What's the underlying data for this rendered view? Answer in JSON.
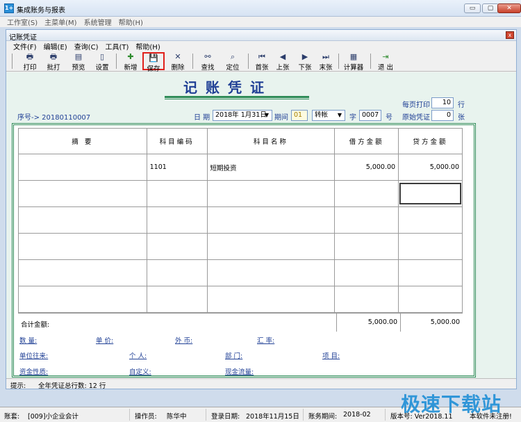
{
  "app": {
    "title": "集成账务与报表"
  },
  "outer_menu": [
    "工作室(S)",
    "主菜单(M)",
    "系统管理",
    "帮助(H)"
  ],
  "window_buttons": {
    "minimize": "▭",
    "maximize": "▢",
    "close": "✕"
  },
  "inner": {
    "title": "记账凭证",
    "close": "x",
    "menu": [
      "文件(F)",
      "编辑(E)",
      "查询(C)",
      "工具(T)",
      "帮助(H)"
    ]
  },
  "toolbar": {
    "print": "打印",
    "batch_print": "批打",
    "preview": "预览",
    "settings": "设置",
    "add": "新增",
    "save": "保存",
    "delete": "删除",
    "find": "查找",
    "locate": "定位",
    "first": "首张",
    "prev": "上张",
    "next": "下张",
    "last": "末张",
    "calculator": "计算器",
    "exit": "退 出"
  },
  "voucher": {
    "title": "记账凭证",
    "seq_label": "序号-> 20180110007",
    "date_label": "日 期",
    "date_value": "2018年 1月31日",
    "period_label": "期间",
    "period_value": "01",
    "type_value": "转帐",
    "word_label": "字",
    "word_value": "0007",
    "number_label": "号",
    "per_page_label": "每页打印",
    "per_page_value": "10",
    "per_page_unit": "行",
    "orig_label": "原始凭证",
    "orig_value": "0",
    "orig_unit": "张"
  },
  "grid": {
    "headers": [
      "摘 要",
      "科目编码",
      "科目名称",
      "借方金额",
      "贷方金额"
    ],
    "rows": [
      {
        "summary": "",
        "code": "1101",
        "name": "短期投资",
        "debit": "5,000.00",
        "credit": "5,000.00"
      },
      {
        "summary": "",
        "code": "",
        "name": "",
        "debit": "",
        "credit": ""
      },
      {
        "summary": "",
        "code": "",
        "name": "",
        "debit": "",
        "credit": ""
      },
      {
        "summary": "",
        "code": "",
        "name": "",
        "debit": "",
        "credit": ""
      },
      {
        "summary": "",
        "code": "",
        "name": "",
        "debit": "",
        "credit": ""
      },
      {
        "summary": "",
        "code": "",
        "name": "",
        "debit": "",
        "credit": ""
      }
    ],
    "total_label": "合计金额:",
    "total_debit": "5,000.00",
    "total_credit": "5,000.00"
  },
  "aux_fields": {
    "quantity": "数 量:",
    "unit_price": "单 价:",
    "foreign": "外 币:",
    "rate": "汇 率:",
    "unit_trans": "单位往来:",
    "person": "个 人:",
    "dept": "部 门:",
    "project": "项 目:",
    "fund_nature": "资金性质:",
    "custom": "自定义:",
    "cash_flow": "现金流量:"
  },
  "hint": {
    "label": "提示:",
    "text": "全年凭证总行数: 12 行"
  },
  "status": {
    "account": "账套:",
    "account_value": "[009]小企业会计",
    "operator": "操作员:",
    "operator_value": "陈华中",
    "login_date": "登录日期:",
    "login_value": "2018年11月15日",
    "period": "账务期间:",
    "period_value": "2018-02",
    "version": "版本号: Ver2018.11",
    "register": "本软件未注册!"
  },
  "watermark": "极速下载站"
}
